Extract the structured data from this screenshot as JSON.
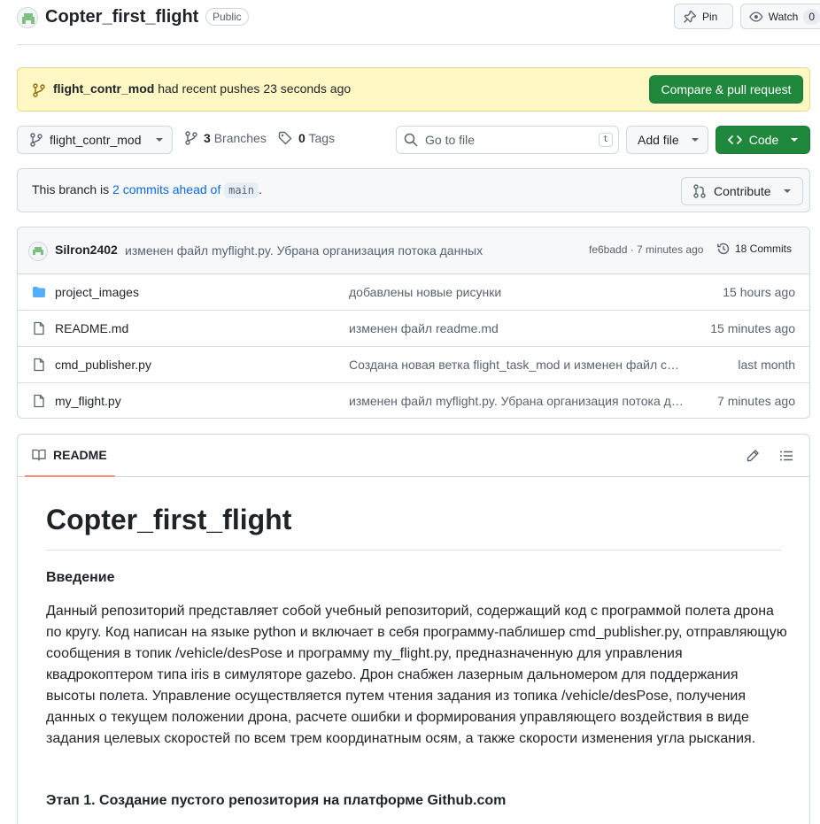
{
  "repo": {
    "name": "Copter_first_flight",
    "visibility": "Public",
    "pin_label": "Pin",
    "watch_label": "Watch",
    "watch_count": "0"
  },
  "banner": {
    "branch": "flight_contr_mod",
    "text": " had recent pushes 23 seconds ago",
    "button": "Compare & pull request"
  },
  "toolbar": {
    "branch": "flight_contr_mod",
    "branches_count": "3",
    "branches_label": "Branches",
    "tags_count": "0",
    "tags_label": "Tags",
    "goto_placeholder": "Go to file",
    "goto_key": "t",
    "add_file": "Add file",
    "code": "Code"
  },
  "ahead": {
    "prefix": "This branch is ",
    "link": "2 commits ahead of",
    "base": "main",
    "suffix": ".",
    "contribute": "Contribute"
  },
  "latest_commit": {
    "author": "Silron2402",
    "message": "изменен файл myflight.py. Убрана организация потока данных",
    "meta": "fe6badd · 7 minutes ago",
    "commits": "18 Commits"
  },
  "files": [
    {
      "name": "project_images",
      "type": "folder",
      "message": "добавлены новые рисунки",
      "date": "15 hours ago"
    },
    {
      "name": "README.md",
      "type": "file",
      "message": "изменен файл readme.md",
      "date": "15 minutes ago"
    },
    {
      "name": "cmd_publisher.py",
      "type": "file",
      "message": "Создана новая ветка flight_task_mod и изменен файл cmd_publisher.py",
      "date": "last month"
    },
    {
      "name": "my_flight.py",
      "type": "file",
      "message": "изменен файл myflight.py. Убрана организация потока данных",
      "date": "7 minutes ago"
    }
  ],
  "readme": {
    "tab": "README",
    "title": "Copter_first_flight",
    "h_intro": "Введение",
    "intro": "Данный репозиторий представляет собой учебный репозиторий, содержащий код с программой полета дрона по кругу. Код написан на языке python и включает в себя программу-паблишер cmd_publisher.py, отправляющую сообщения в топик /vehicle/desPose и программу my_flight.py, предназначенную для управления квадрокоптером типа iris в симуляторе gazebo. Дрон снабжен лазерным дальномером для поддержания высоты полета. Управление осуществляется путем чтения задания из топика /vehicle/desPose, получения данных о текущем положении дрона, расчете ошибки и формирования управляющего воздействия в виде задания целевых скоростей по всем трем координатным осям, а также скорости изменения угла рыскания.",
    "h_stage1": "Этап 1. Создание пустого репозитория на платформе Github.com"
  },
  "colors": {
    "accent": "#0969da",
    "green": "#1f883d",
    "banner_bg": "#fff8c5",
    "folder": "#54aeff",
    "tab_underline": "#fd8c73"
  }
}
